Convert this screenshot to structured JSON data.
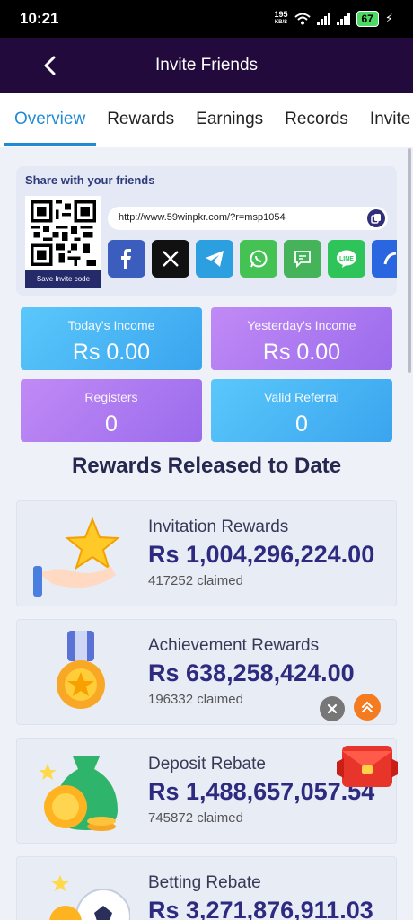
{
  "status_bar": {
    "time": "10:21",
    "speed_value": "195",
    "speed_unit": "KB/S",
    "battery": "67"
  },
  "header": {
    "title": "Invite Friends"
  },
  "tabs": [
    {
      "label": "Overview"
    },
    {
      "label": "Rewards"
    },
    {
      "label": "Earnings"
    },
    {
      "label": "Records"
    },
    {
      "label": "Invite"
    }
  ],
  "share": {
    "title": "Share with your friends",
    "save_label": "Save Invite code",
    "link": "http://www.59winpkr.com/?r=msp1054",
    "socials": [
      {
        "icon": "facebook-icon",
        "color": "#3b5dbd"
      },
      {
        "icon": "x-icon",
        "color": "#111111"
      },
      {
        "icon": "telegram-icon",
        "color": "#2b9fe0"
      },
      {
        "icon": "whatsapp-icon",
        "color": "#45c254"
      },
      {
        "icon": "sms-icon",
        "color": "#45b35a"
      },
      {
        "icon": "line-icon",
        "color": "#2fc45a"
      },
      {
        "icon": "more-icon",
        "color": "#2a66e0"
      }
    ]
  },
  "stats": {
    "today": {
      "label": "Today's Income",
      "value": "Rs 0.00"
    },
    "yesterday": {
      "label": "Yesterday's Income",
      "value": "Rs 0.00"
    },
    "registers": {
      "label": "Registers",
      "value": "0"
    },
    "valid_referral": {
      "label": "Valid Referral",
      "value": "0"
    }
  },
  "rewards_section": {
    "title": "Rewards Released to Date"
  },
  "rewards": [
    {
      "title": "Invitation Rewards",
      "amount": "Rs 1,004,296,224.00",
      "claimed": "417252 claimed"
    },
    {
      "title": "Achievement Rewards",
      "amount": "Rs 638,258,424.00",
      "claimed": "196332 claimed"
    },
    {
      "title": "Deposit Rebate",
      "amount": "Rs 1,488,657,057.54",
      "claimed": "745872 claimed"
    },
    {
      "title": "Betting Rebate",
      "amount": "Rs 3,271,876,911.03",
      "claimed": ""
    }
  ],
  "colors": {
    "header_bg": "#220a3d",
    "accent": "#1f8bd6",
    "amount": "#2e2a80"
  }
}
